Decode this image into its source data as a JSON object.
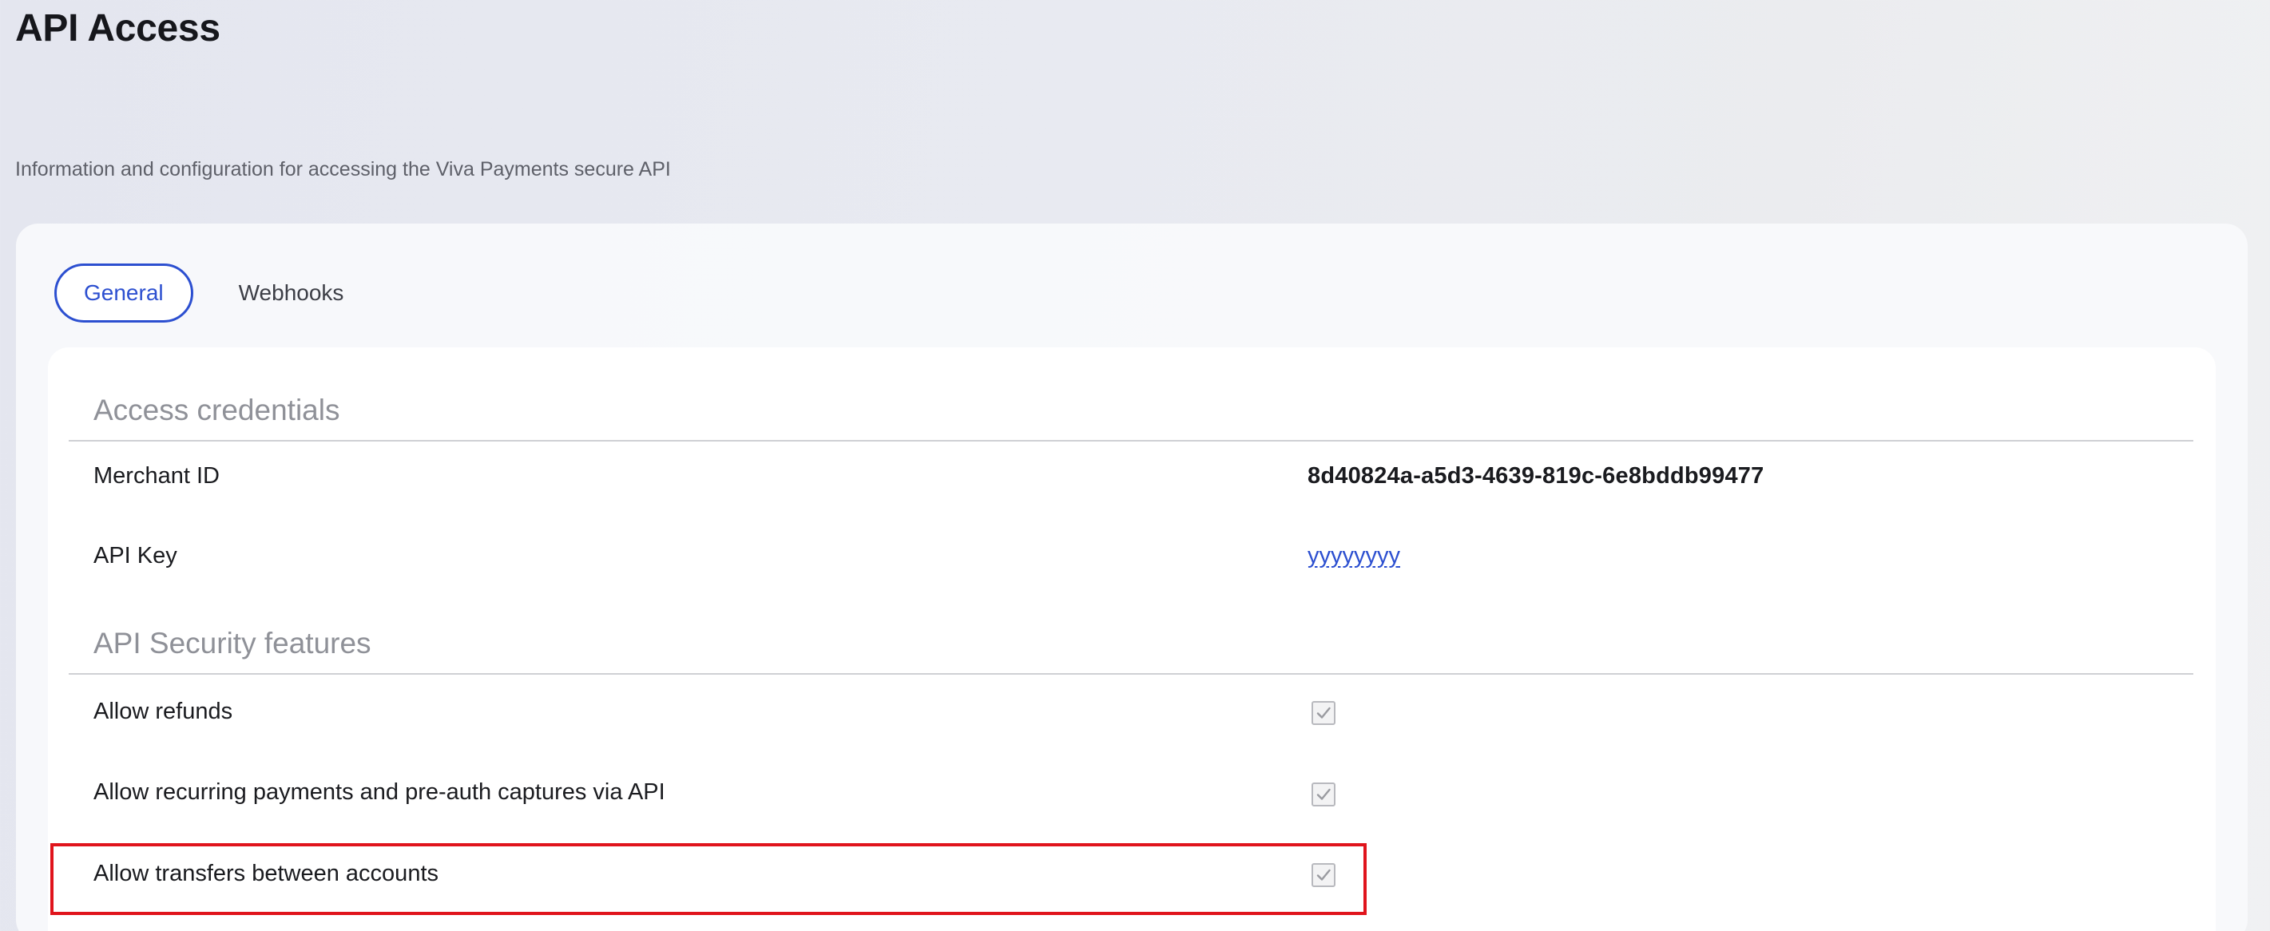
{
  "page": {
    "title": "API Access",
    "subtitle": "Information and configuration for accessing the Viva Payments secure API"
  },
  "tabs": [
    {
      "label": "General",
      "active": true
    },
    {
      "label": "Webhooks",
      "active": false
    }
  ],
  "access_credentials": {
    "title": "Access credentials",
    "rows": [
      {
        "label": "Merchant ID",
        "value": "8d40824a-a5d3-4639-819c-6e8bddb99477"
      },
      {
        "label": "API Key",
        "value": "yyyyyyyy"
      }
    ]
  },
  "security_features": {
    "title": "API Security features",
    "rows": [
      {
        "label": "Allow refunds",
        "checked": true
      },
      {
        "label": "Allow recurring payments and pre-auth captures via API",
        "checked": true
      },
      {
        "label": "Allow transfers between accounts",
        "checked": true,
        "highlighted": true
      }
    ]
  },
  "colors": {
    "accent": "#2c4fd0",
    "highlight": "#e0141c"
  }
}
